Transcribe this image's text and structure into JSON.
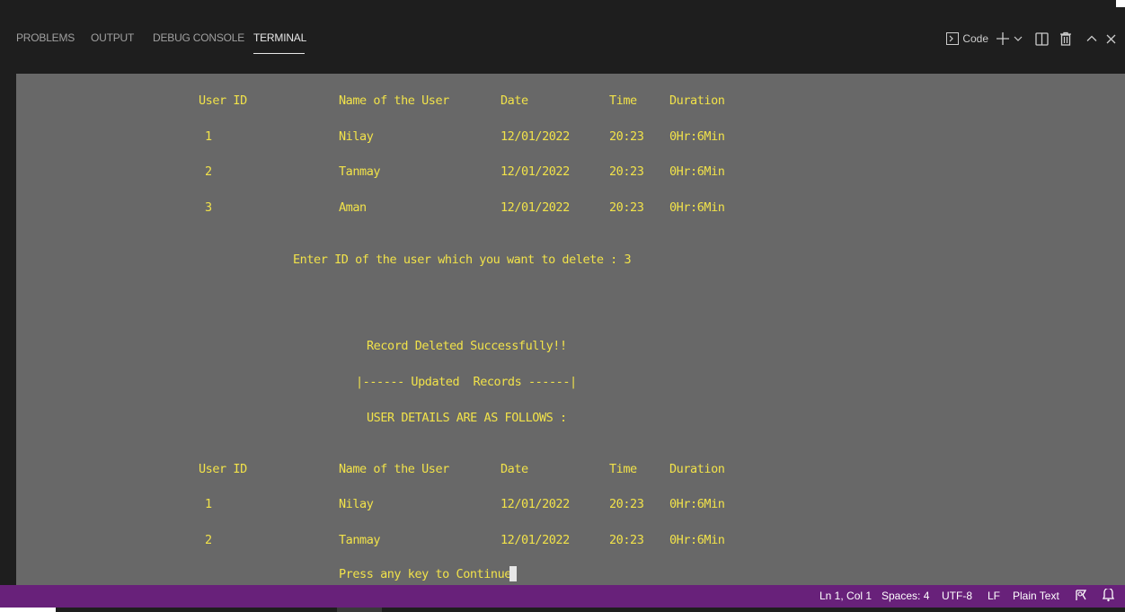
{
  "panel": {
    "tabs": [
      "PROBLEMS",
      "OUTPUT",
      "DEBUG CONSOLE",
      "TERMINAL"
    ],
    "active_tab": "TERMINAL",
    "terminal_name": "Code"
  },
  "terminal": {
    "table1": {
      "headers": [
        "User ID",
        "Name of the User",
        "Date",
        "Time",
        "Duration"
      ],
      "rows": [
        [
          "1",
          "Nilay",
          "12/01/2022",
          "20:23",
          "0Hr:6Min"
        ],
        [
          "2",
          "Tanmay",
          "12/01/2022",
          "20:23",
          "0Hr:6Min"
        ],
        [
          "3",
          "Aman",
          "12/01/2022",
          "20:23",
          "0Hr:6Min"
        ]
      ]
    },
    "prompt": "Enter ID of the user which you want to delete : 3",
    "deleted_message": "Record Deleted Successfully!!",
    "updated_banner": "|------ Updated  Records ------|",
    "details_heading": "USER DETAILS ARE AS FOLLOWS :",
    "table2": {
      "headers": [
        "User ID",
        "Name of the User",
        "Date",
        "Time",
        "Duration"
      ],
      "rows": [
        [
          "1",
          "Nilay",
          "12/01/2022",
          "20:23",
          "0Hr:6Min"
        ],
        [
          "2",
          "Tanmay",
          "12/01/2022",
          "20:23",
          "0Hr:6Min"
        ]
      ]
    },
    "continue_prompt": "Press any key to Continue"
  },
  "status": {
    "position": "Ln 1, Col 1",
    "spaces": "Spaces: 4",
    "encoding": "UTF-8",
    "eol": "LF",
    "language": "Plain Text"
  },
  "colors": {
    "terminal_bg": "#686868",
    "terminal_text": "#f1e24a",
    "statusbar_bg": "#68217a",
    "panel_bg": "#1e1e1e"
  },
  "icons": [
    "terminal-icon",
    "plus-icon",
    "chevron-down-icon",
    "split-icon",
    "trash-icon",
    "chevron-up-icon",
    "close-icon",
    "feedback-icon",
    "bell-icon"
  ]
}
